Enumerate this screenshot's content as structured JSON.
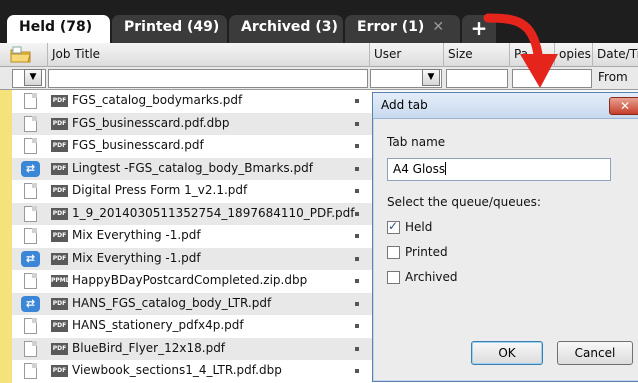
{
  "tabs": [
    {
      "label": "Held (78)",
      "active": true
    },
    {
      "label": "Printed (49)",
      "active": false
    },
    {
      "label": "Archived (3)",
      "active": false
    },
    {
      "label": "Error (1)",
      "active": false,
      "closable": true
    }
  ],
  "tab_plus": "+",
  "tab_close_glyph": "✕",
  "columns": {
    "job_title": "Job Title",
    "user": "User",
    "size": "Size",
    "pages": "Pa",
    "copies": "opies",
    "date": "Date/Ti"
  },
  "filter": {
    "date_from": "From",
    "dropdown_glyph": "▼"
  },
  "jobs": [
    {
      "name": "FGS_catalog_bodymarks.pdf",
      "icon": "document",
      "type": "pdf"
    },
    {
      "name": "FGS_businesscard.pdf.dbp",
      "icon": "document",
      "type": "pdf"
    },
    {
      "name": "FGS_businesscard.pdf",
      "icon": "document",
      "type": "pdf"
    },
    {
      "name": "Lingtest -FGS_catalog_body_Bmarks.pdf",
      "icon": "workflow",
      "type": "pdf"
    },
    {
      "name": "Digital Press Form 1_v2.1.pdf",
      "icon": "document",
      "type": "pdf"
    },
    {
      "name": "1_9_2014030511352754_1897684110_PDF.pdf",
      "icon": "document",
      "type": "pdf"
    },
    {
      "name": "Mix Everything -1.pdf",
      "icon": "document",
      "type": "pdf"
    },
    {
      "name": "Mix Everything -1.pdf",
      "icon": "workflow",
      "type": "pdf"
    },
    {
      "name": "HappyBDayPostcardCompleted.zip.dbp",
      "icon": "document",
      "type": "ppml"
    },
    {
      "name": "HANS_FGS_catalog_body_LTR.pdf",
      "icon": "workflow",
      "type": "pdf"
    },
    {
      "name": "HANS_stationery_pdfx4p.pdf",
      "icon": "document",
      "type": "pdf"
    },
    {
      "name": "BlueBird_Flyer_12x18.pdf",
      "icon": "document",
      "type": "pdf"
    },
    {
      "name": "Viewbook_sections1_4_LTR.pdf.dbp",
      "icon": "document",
      "type": "pdf"
    }
  ],
  "type_badges": {
    "pdf": "PDF",
    "ppml": "PPML"
  },
  "dialog": {
    "title": "Add tab",
    "close_glyph": "✕",
    "tab_name_label": "Tab name",
    "tab_name_value": "A4 Gloss",
    "queue_label": "Select the queue/queues:",
    "queues": [
      {
        "label": "Held",
        "checked": true
      },
      {
        "label": "Printed",
        "checked": false
      },
      {
        "label": "Archived",
        "checked": false
      }
    ],
    "ok_label": "OK",
    "cancel_label": "Cancel"
  },
  "colors": {
    "accent_arrow": "#e5241c",
    "tab_bar": "#1e1e1e",
    "held_marker": "#f3e37a"
  }
}
